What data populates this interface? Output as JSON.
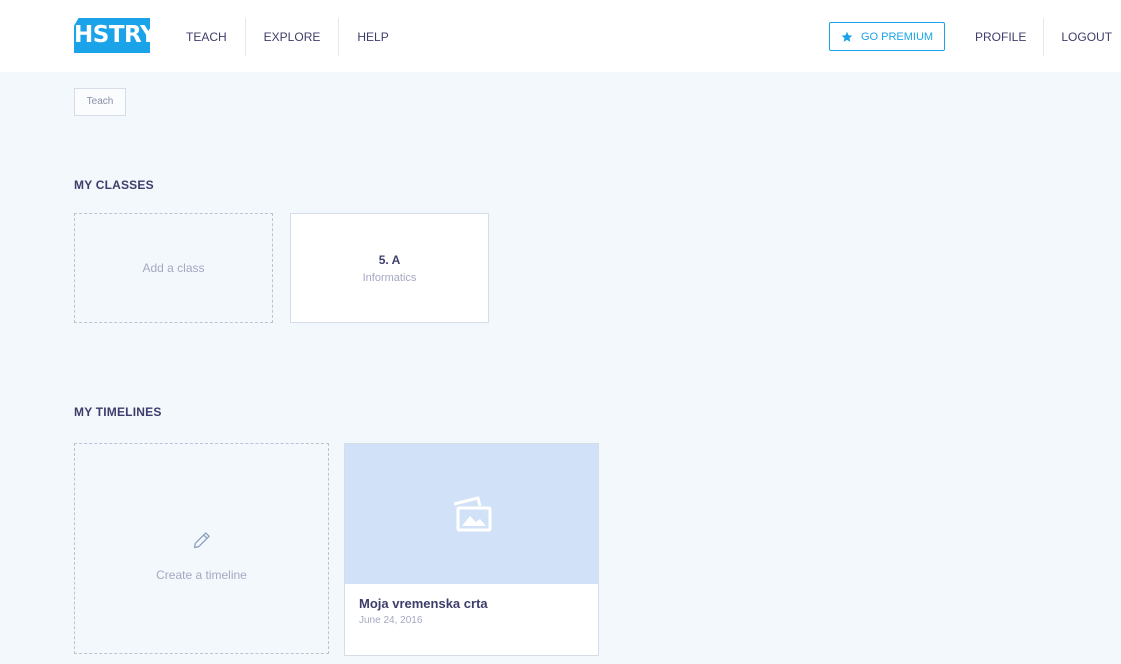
{
  "header": {
    "logo_text": "HSTRY",
    "nav": [
      {
        "label": "TEACH"
      },
      {
        "label": "EXPLORE"
      },
      {
        "label": "HELP"
      }
    ],
    "premium_label": "GO PREMIUM",
    "profile_label": "PROFILE",
    "logout_label": "LOGOUT"
  },
  "breadcrumb": {
    "label": "Teach"
  },
  "classes": {
    "title": "MY CLASSES",
    "add_label": "Add a class",
    "items": [
      {
        "name": "5. A",
        "subject": "Informatics"
      }
    ]
  },
  "timelines": {
    "title": "MY TIMELINES",
    "create_label": "Create a timeline",
    "items": [
      {
        "title": "Moja vremenska crta",
        "date": "June 24, 2016"
      }
    ]
  },
  "colors": {
    "accent": "#1aa3e8",
    "background": "#f3f8fd",
    "thumbnail": "#d1e1f7"
  }
}
